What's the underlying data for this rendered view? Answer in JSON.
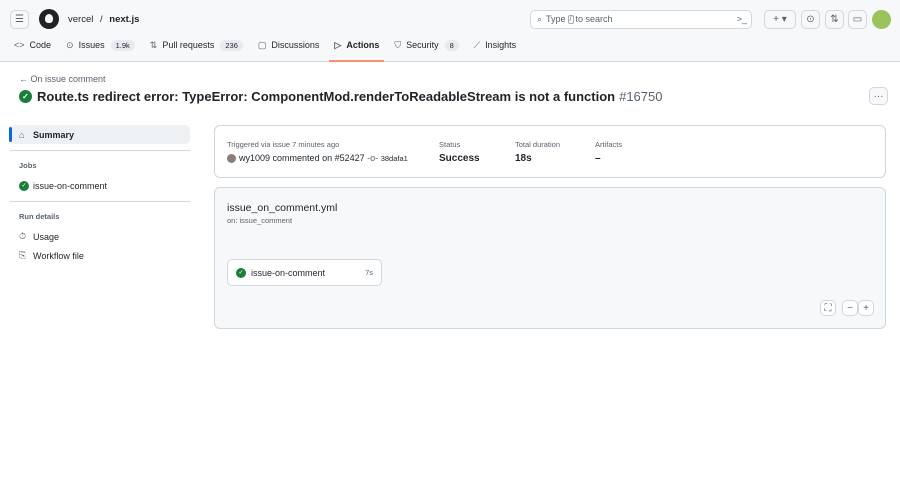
{
  "header": {
    "owner": "vercel",
    "separator": "/",
    "repo": "next.js",
    "search_prefix": "Type",
    "search_key": "/",
    "search_suffix": "to search"
  },
  "nav": [
    {
      "label": "Code",
      "icon": "code-icon"
    },
    {
      "label": "Issues",
      "count": "1.9k",
      "icon": "issue-icon"
    },
    {
      "label": "Pull requests",
      "count": "236",
      "icon": "pull-request-icon"
    },
    {
      "label": "Discussions",
      "icon": "discussion-icon"
    },
    {
      "label": "Actions",
      "icon": "play-icon",
      "selected": true
    },
    {
      "label": "Security",
      "count": "8",
      "icon": "shield-icon"
    },
    {
      "label": "Insights",
      "icon": "graph-icon"
    }
  ],
  "page": {
    "back": "On issue comment",
    "title": "Route.ts redirect error: TypeError: ComponentMod.renderToReadableStream is not a function",
    "run_number": "#16750"
  },
  "sidebar": {
    "summary": "Summary",
    "jobs_heading": "Jobs",
    "job": "issue-on-comment",
    "run_details_heading": "Run details",
    "usage": "Usage",
    "workflow_file": "Workflow file"
  },
  "run": {
    "triggered": "Triggered via issue 7 minutes ago",
    "user": "wy1009",
    "action": "commented on",
    "issue": "#52427",
    "commit": "38dafa1",
    "status_label": "Status",
    "status": "Success",
    "duration_label": "Total duration",
    "duration": "18s",
    "artifacts_label": "Artifacts",
    "artifacts": "–"
  },
  "workflow": {
    "file": "issue_on_comment.yml",
    "trigger": "on: issue_comment",
    "job": "issue-on-comment",
    "job_duration": "7s"
  },
  "colors": {
    "success": "#1a7f37",
    "accent": "#0969da",
    "tab_underline": "#fd8c73"
  }
}
